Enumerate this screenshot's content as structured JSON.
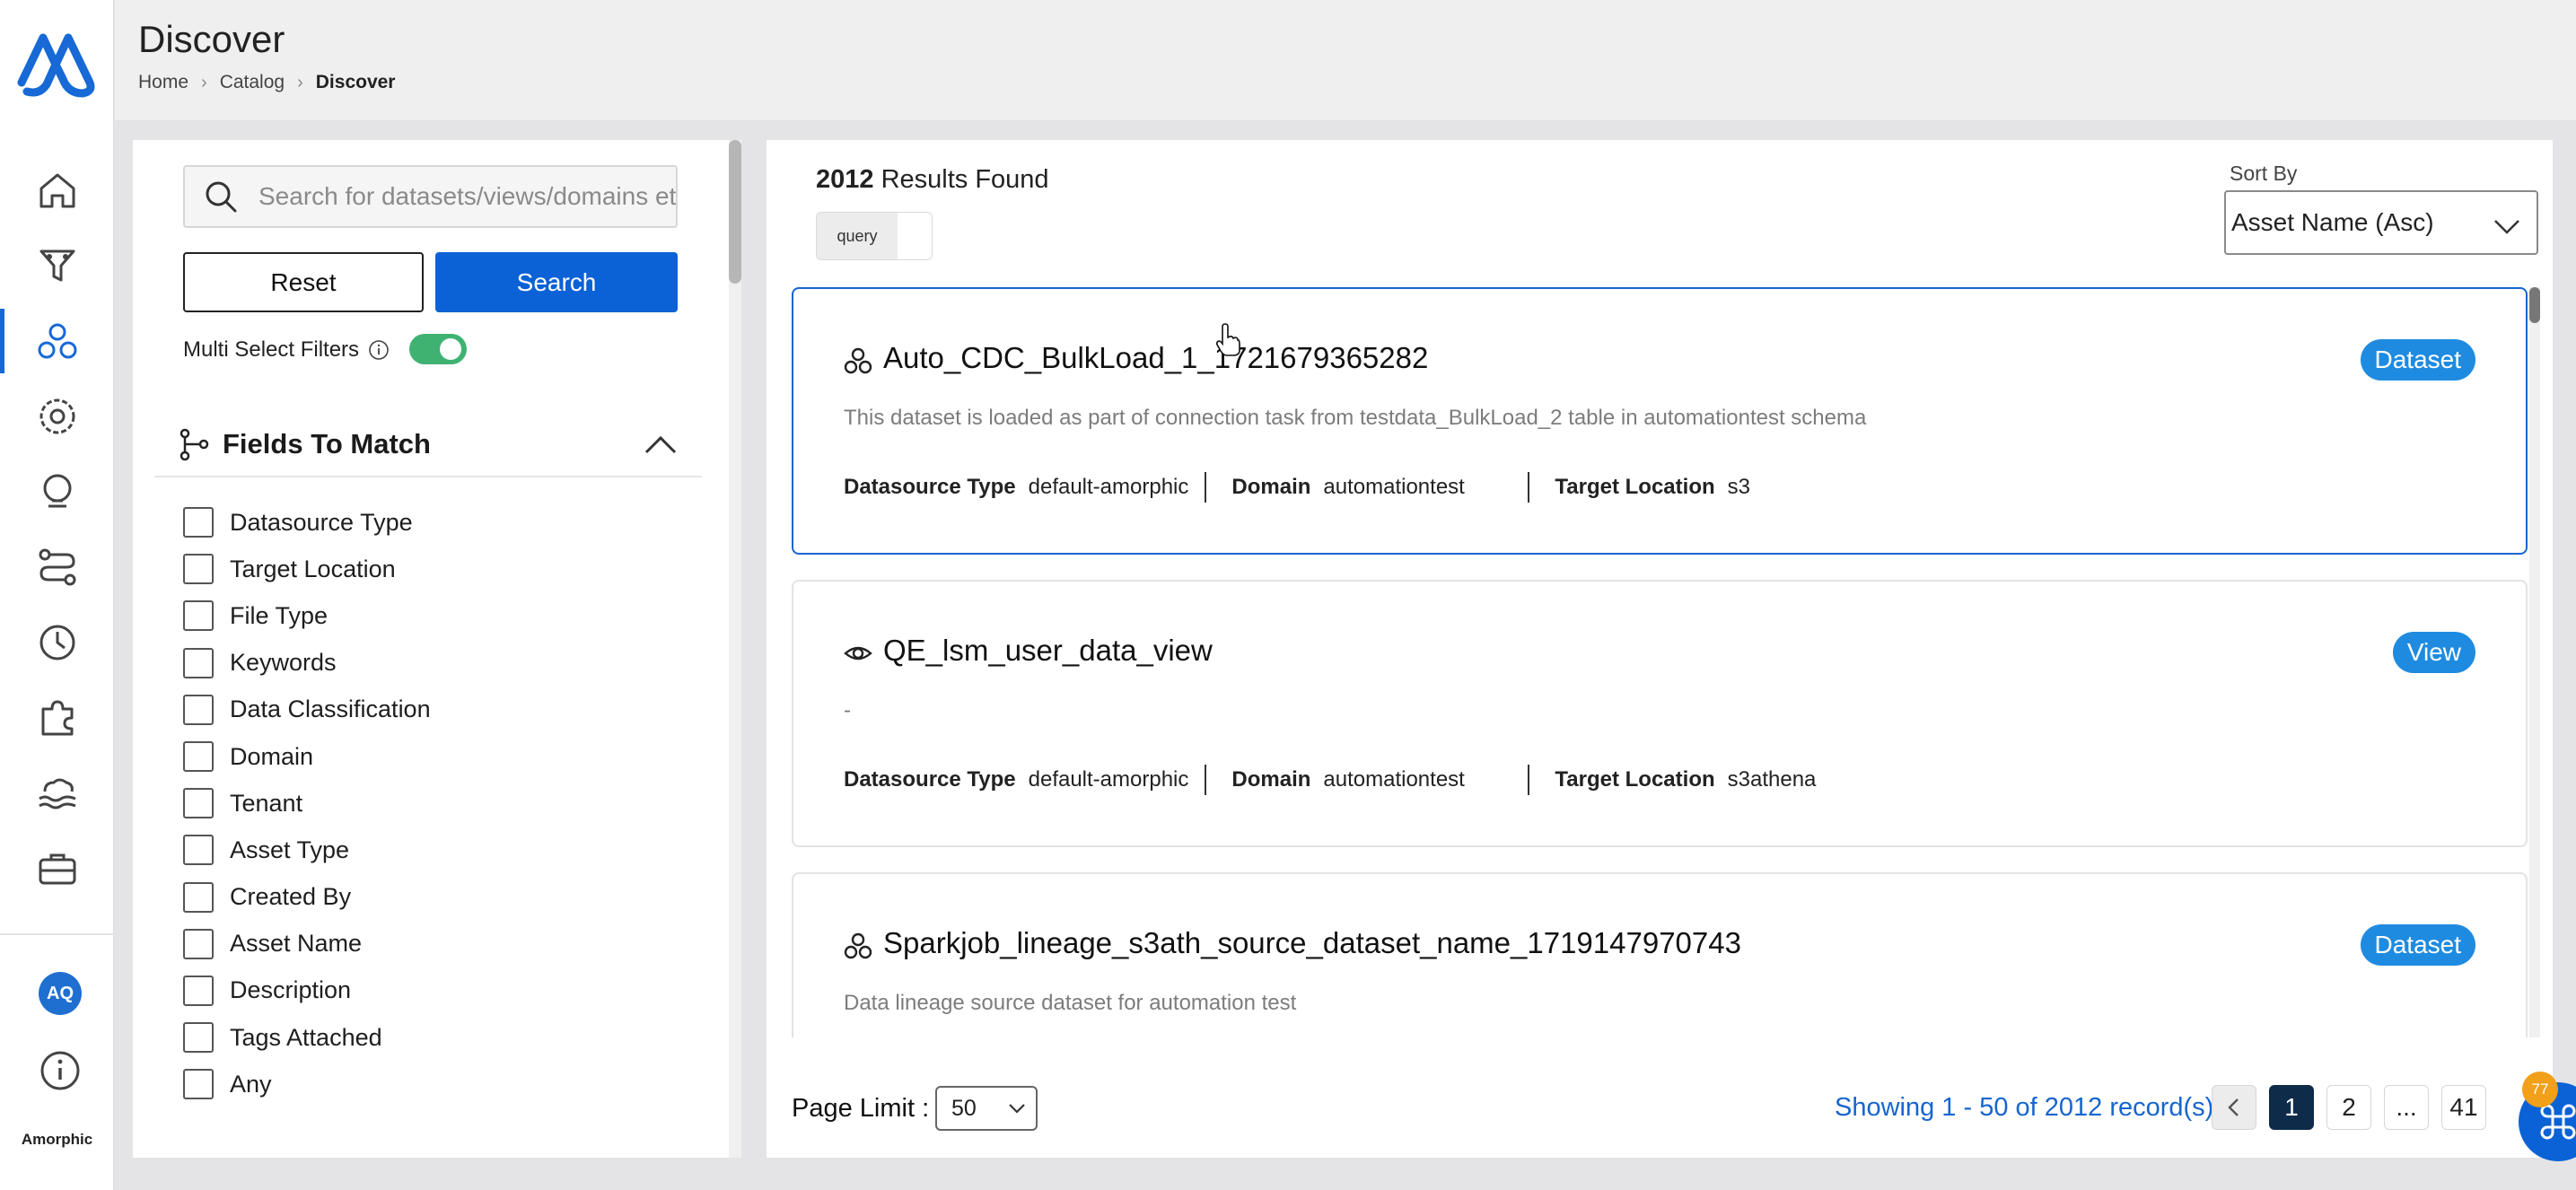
{
  "app": {
    "brand": "Amorphic",
    "user_initials": "AQ"
  },
  "header": {
    "title": "Discover",
    "breadcrumbs": [
      "Home",
      "Catalog",
      "Discover"
    ]
  },
  "nav": {
    "items": [
      {
        "icon": "home-icon"
      },
      {
        "icon": "funnel-icon"
      },
      {
        "icon": "discover-icon",
        "active": true
      },
      {
        "icon": "settings-gear-icon"
      },
      {
        "icon": "lamp-icon"
      },
      {
        "icon": "pipeline-icon"
      },
      {
        "icon": "clock-icon"
      },
      {
        "icon": "puzzle-icon"
      },
      {
        "icon": "cloud-waves-icon"
      },
      {
        "icon": "briefcase-icon"
      }
    ]
  },
  "filters": {
    "search_placeholder": "Search for datasets/views/domains etc",
    "reset_label": "Reset",
    "search_label": "Search",
    "multi_select_label": "Multi Select Filters",
    "multi_select_on": true,
    "fields_title": "Fields To Match",
    "fields": [
      "Datasource Type",
      "Target Location",
      "File Type",
      "Keywords",
      "Data Classification",
      "Domain",
      "Tenant",
      "Asset Type",
      "Created By",
      "Asset Name",
      "Description",
      "Tags Attached",
      "Any"
    ]
  },
  "results": {
    "count": "2012",
    "count_suffix": "Results Found",
    "query_toggle_label": "query",
    "sort_label": "Sort By",
    "sort_value": "Asset Name (Asc)",
    "cards": [
      {
        "name": "Auto_CDC_BulkLoad_1_1721679365282",
        "badge": "Dataset",
        "icon": "dataset-icon",
        "description": "This dataset is loaded as part of connection task from testdata_BulkLoad_2 table in automationtest schema",
        "datasource_key": "Datasource Type",
        "datasource_value": "default-amorphic",
        "domain_key": "Domain",
        "domain_value": "automationtest",
        "target_key": "Target Location",
        "target_value": "s3"
      },
      {
        "name": "QE_lsm_user_data_view",
        "badge": "View",
        "icon": "view-icon",
        "description": "-",
        "datasource_key": "Datasource Type",
        "datasource_value": "default-amorphic",
        "domain_key": "Domain",
        "domain_value": "automationtest",
        "target_key": "Target Location",
        "target_value": "s3athena"
      },
      {
        "name": "Sparkjob_lineage_s3ath_source_dataset_name_1719147970743",
        "badge": "Dataset",
        "icon": "dataset-icon",
        "description": "Data lineage source dataset for automation test",
        "datasource_key": "",
        "datasource_value": "",
        "domain_key": "",
        "domain_value": "",
        "target_key": "",
        "target_value": ""
      }
    ]
  },
  "footer": {
    "page_limit_label": "Page Limit :",
    "page_limit_value": "50",
    "showing": "Showing 1 - 50 of 2012 record(s)",
    "pages": [
      "1",
      "2",
      "...",
      "41"
    ],
    "fab_badge": "77"
  },
  "colors": {
    "primary": "#0a62d6",
    "badge": "#1f8be0",
    "toggle_on": "#3fb272",
    "active_page": "#0f2b4a",
    "notification": "#f2a01a"
  }
}
